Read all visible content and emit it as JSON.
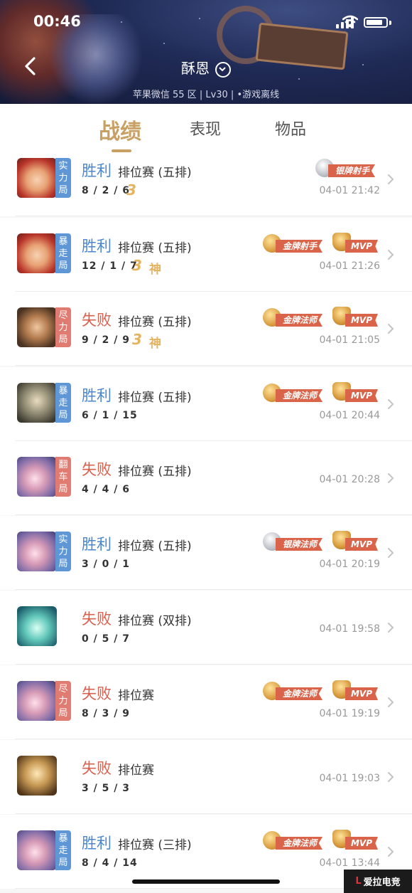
{
  "status_bar": {
    "time": "00:46"
  },
  "header": {
    "player_name": "酥恩",
    "sub_info": "苹果微信 55 区 | Lv30 | •游戏离线"
  },
  "tabs": [
    {
      "label": "战绩",
      "active": true
    },
    {
      "label": "表现",
      "active": false
    },
    {
      "label": "物品",
      "active": false
    }
  ],
  "matches": [
    {
      "tag": "实力局",
      "tag_color": "blue",
      "result": "胜利",
      "mode": "排位赛 (五排)",
      "kda": "8 / 2 / 6",
      "multi": "3",
      "shen": "",
      "honor": "银牌射手",
      "honor_type": "silver",
      "mvp": "",
      "time": "04-01 21:42",
      "avatar": "hero-a"
    },
    {
      "tag": "暴走局",
      "tag_color": "blue",
      "result": "胜利",
      "mode": "排位赛 (五排)",
      "kda": "12 / 1 / 7",
      "multi": "3",
      "shen": "神",
      "honor": "金牌射手",
      "honor_type": "gold",
      "mvp": "MVP",
      "time": "04-01 21:26",
      "avatar": "hero-a"
    },
    {
      "tag": "尽力局",
      "tag_color": "red",
      "result": "失败",
      "mode": "排位赛 (五排)",
      "kda": "9 / 2 / 9",
      "multi": "3",
      "shen": "神",
      "honor": "金牌法师",
      "honor_type": "gold",
      "mvp": "MVP",
      "time": "04-01 21:05",
      "avatar": "hero-b"
    },
    {
      "tag": "暴走局",
      "tag_color": "blue",
      "result": "胜利",
      "mode": "排位赛 (五排)",
      "kda": "6 / 1 / 15",
      "multi": "",
      "shen": "",
      "honor": "金牌法师",
      "honor_type": "gold",
      "mvp": "MVP",
      "time": "04-01 20:44",
      "avatar": "hero-c"
    },
    {
      "tag": "翻车局",
      "tag_color": "red",
      "result": "失败",
      "mode": "排位赛 (五排)",
      "kda": "4 / 4 / 6",
      "multi": "",
      "shen": "",
      "honor": "",
      "honor_type": "",
      "mvp": "",
      "time": "04-01 20:28",
      "avatar": "hero-d"
    },
    {
      "tag": "实力局",
      "tag_color": "blue",
      "result": "胜利",
      "mode": "排位赛 (五排)",
      "kda": "3 / 0 / 1",
      "multi": "",
      "shen": "",
      "honor": "银牌法师",
      "honor_type": "silver",
      "mvp": "MVP",
      "time": "04-01 20:19",
      "avatar": "hero-d"
    },
    {
      "tag": "",
      "tag_color": "",
      "result": "失败",
      "mode": "排位赛 (双排)",
      "kda": "0 / 5 / 7",
      "multi": "",
      "shen": "",
      "honor": "",
      "honor_type": "",
      "mvp": "",
      "time": "04-01 19:58",
      "avatar": "hero-e"
    },
    {
      "tag": "尽力局",
      "tag_color": "red",
      "result": "失败",
      "mode": "排位赛",
      "kda": "8 / 3 / 9",
      "multi": "",
      "shen": "",
      "honor": "金牌法师",
      "honor_type": "gold",
      "mvp": "MVP",
      "time": "04-01 19:19",
      "avatar": "hero-d"
    },
    {
      "tag": "",
      "tag_color": "",
      "result": "失败",
      "mode": "排位赛",
      "kda": "3 / 5 / 3",
      "multi": "",
      "shen": "",
      "honor": "",
      "honor_type": "",
      "mvp": "",
      "time": "04-01 19:03",
      "avatar": "hero-f"
    },
    {
      "tag": "暴走局",
      "tag_color": "blue",
      "result": "胜利",
      "mode": "排位赛 (三排)",
      "kda": "8 / 4 / 14",
      "multi": "",
      "shen": "",
      "honor": "金牌法师",
      "honor_type": "gold",
      "mvp": "MVP",
      "time": "04-01 13:44",
      "avatar": "hero-d"
    }
  ],
  "watermark": {
    "mark": "L",
    "text": "爱拉电竞"
  }
}
